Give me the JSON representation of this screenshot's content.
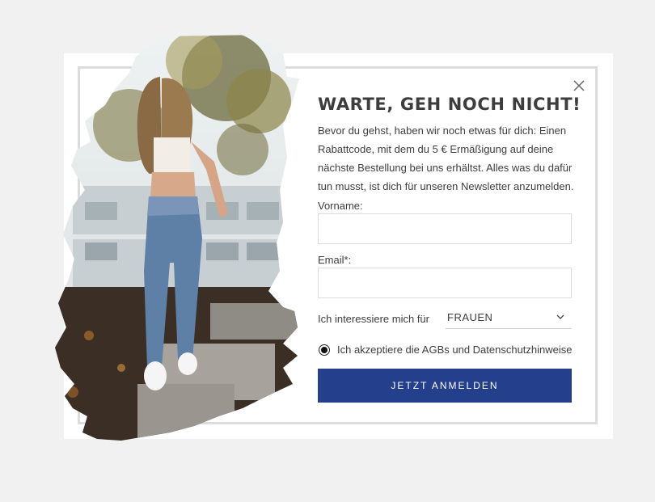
{
  "popup": {
    "headline": "WARTE, GEH NOCH NICHT!",
    "description": "Bevor du gehst, haben wir noch etwas für dich: Einen Rabattcode, mit dem du 5 € Ermäßigung auf deine nächste Bestellung bei uns erhältst. Alles was du dafür tun musst, ist dich für unseren Newsletter anzumelden.",
    "close_icon": "close-icon",
    "form": {
      "firstname_label": "Vorname:",
      "firstname_value": "",
      "email_label": "Email*:",
      "email_value": "",
      "interest_label": "Ich interessiere mich für",
      "interest_selected": "FRAUEN",
      "consent_label": "Ich akzeptiere die AGBs und Datenschutzhinweise",
      "consent_checked": true,
      "submit_label": "JETZT ANMELDEN"
    },
    "colors": {
      "button": "#243f8c",
      "headline": "#3d3d3d",
      "frame": "#dcdcdc",
      "page_background": "#f1f1f1"
    }
  }
}
